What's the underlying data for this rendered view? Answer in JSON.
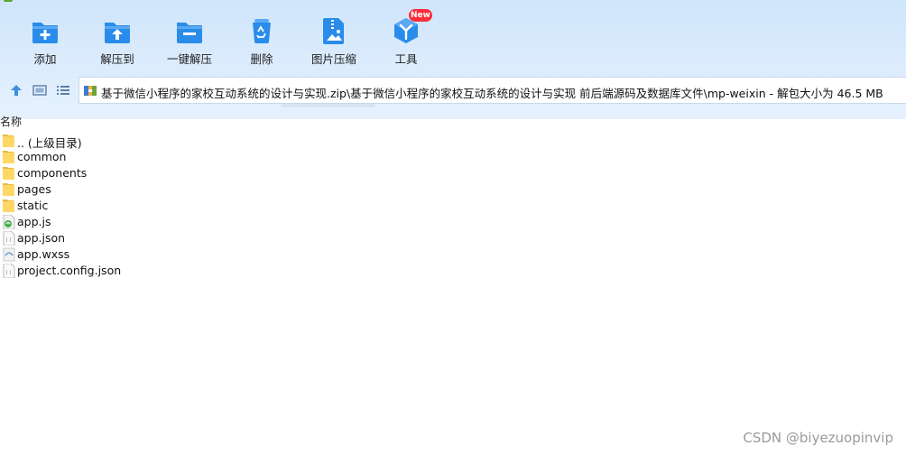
{
  "toolbar": {
    "add_label": "添加",
    "extract_to_label": "解压到",
    "one_click_extract_label": "一键解压",
    "delete_label": "删除",
    "image_compress_label": "图片压缩",
    "tools_label": "工具",
    "new_badge": "New"
  },
  "address": {
    "path": "基于微信小程序的家校互动系统的设计与实现.zip\\基于微信小程序的家校互动系统的设计与实现 前后端源码及数据库文件\\mp-weixin - 解包大小为 46.5 MB"
  },
  "list": {
    "column_name": "名称",
    "items": [
      {
        "name": ".. (上级目录)",
        "type": "folder"
      },
      {
        "name": "common",
        "type": "folder"
      },
      {
        "name": "components",
        "type": "folder"
      },
      {
        "name": "pages",
        "type": "folder"
      },
      {
        "name": "static",
        "type": "folder"
      },
      {
        "name": "app.js",
        "type": "js-file"
      },
      {
        "name": "app.json",
        "type": "file"
      },
      {
        "name": "app.wxss",
        "type": "style-file"
      },
      {
        "name": "project.config.json",
        "type": "file"
      }
    ]
  },
  "watermark": "CSDN @biyezuopinvip",
  "colors": {
    "accent": "#2a8cea",
    "folder": "#ffd766",
    "badge": "#ff2d3c"
  }
}
